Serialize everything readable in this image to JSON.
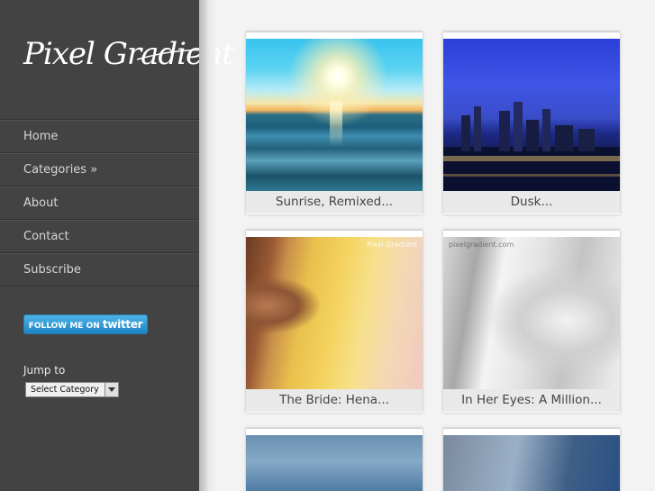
{
  "site": {
    "logo_text": "Pixel Gradient"
  },
  "nav": {
    "items": [
      {
        "label": "Home"
      },
      {
        "label": "Categories »"
      },
      {
        "label": "About"
      },
      {
        "label": "Contact"
      },
      {
        "label": "Subscribe"
      }
    ]
  },
  "twitter": {
    "prefix": "FOLLOW ME ON",
    "brand": "twitter"
  },
  "jump": {
    "label": "Jump to",
    "select_value": "Select Category"
  },
  "posts": [
    {
      "title": "Sunrise, Remixed...",
      "thumb": "sunrise"
    },
    {
      "title": "Dusk...",
      "thumb": "city-dusk"
    },
    {
      "title": "The Bride: Hena...",
      "thumb": "bride",
      "watermark": "Pixel Gradient"
    },
    {
      "title": "In Her Eyes: A Million...",
      "thumb": "bride-bw",
      "watermark": "pixelgradient.com"
    },
    {
      "title": "",
      "thumb": "sea"
    },
    {
      "title": "",
      "thumb": "street"
    }
  ],
  "colors": {
    "sidebar_bg": "#434343",
    "page_bg": "#f3f3f3",
    "caption_bg": "#e9e9e9",
    "twitter_blue": "#1b86c4"
  }
}
